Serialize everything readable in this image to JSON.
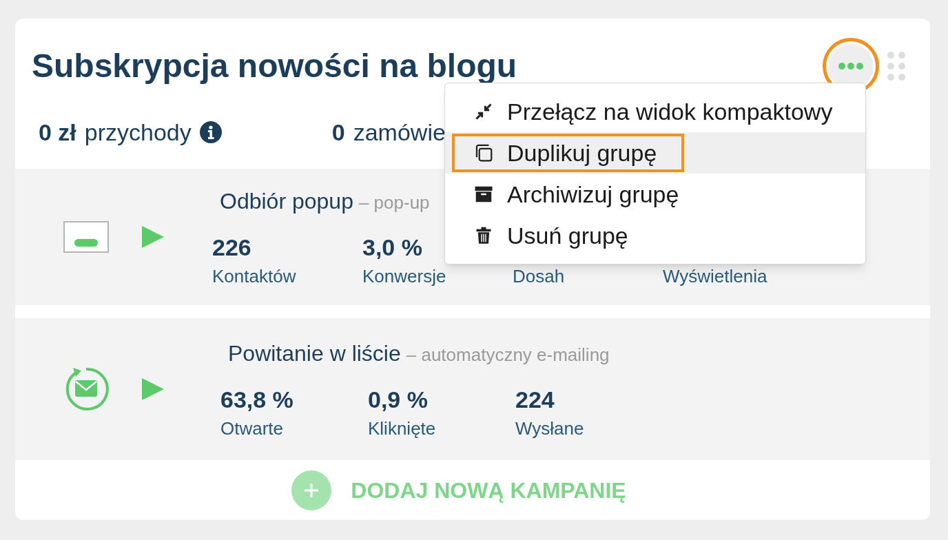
{
  "title": "Subskrypcja nowości na blogu",
  "summary": [
    {
      "value": "0 zł",
      "label": "przychody",
      "info": true
    },
    {
      "value": "0",
      "label": "zamówie",
      "info": false
    }
  ],
  "more_button": {
    "open": true
  },
  "menu": [
    {
      "kind": "compact",
      "label": "Przełącz na widok kompaktowy",
      "selected": false
    },
    {
      "kind": "duplicate",
      "label": "Duplikuj grupę",
      "selected": true
    },
    {
      "kind": "archive",
      "label": "Archiwizuj grupę",
      "selected": false
    },
    {
      "kind": "delete",
      "label": "Usuń grupę",
      "selected": false
    }
  ],
  "campaigns": [
    {
      "kind": "popup",
      "name": "Odbiór popup",
      "type": "– pop-up",
      "metrics": [
        {
          "value": "226",
          "label": "Kontaktów"
        },
        {
          "value": "3,0 %",
          "label": "Konwersje"
        },
        {
          "label": "Dosah"
        },
        {
          "label": "Wyświetlenia"
        }
      ]
    },
    {
      "kind": "email",
      "name": "Powitanie w liście",
      "type": "– automatyczny e-mailing",
      "metrics": [
        {
          "value": "63,8 %",
          "label": "Otwarte"
        },
        {
          "value": "0,9 %",
          "label": "Kliknięte"
        },
        {
          "value": "224",
          "label": "Wysłane"
        }
      ]
    }
  ],
  "add_button": {
    "label": "DODAJ NOWĄ KAMPANIĘ"
  }
}
